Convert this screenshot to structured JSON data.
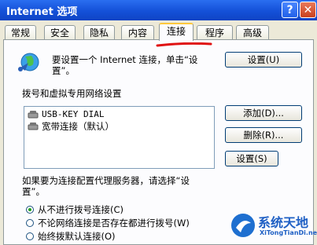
{
  "window": {
    "title": "Internet 选项"
  },
  "title_buttons": {
    "help": "?",
    "close": "✕"
  },
  "tabs": [
    "常规",
    "安全",
    "隐私",
    "内容",
    "连接",
    "程序",
    "高级"
  ],
  "active_tab": "连接",
  "setup": {
    "text_line1": "要设置一个 Internet 连接，单击“设",
    "text_line2": "置”。",
    "button": "设置(U)"
  },
  "dialup": {
    "section_label": "拨号和虚拟专用网络设置",
    "items": [
      "USB-KEY DIAL",
      "宽带连接（默认）"
    ],
    "add_button": "添加(D)...",
    "remove_button": "删除(R)...",
    "settings_button": "设置(S)"
  },
  "proxy": {
    "text_line1": "如果要为连接配置代理服务器，请选择“设",
    "text_line2": "置”。"
  },
  "radio_options": [
    "从不进行拨号连接(C)",
    "不论网络连接是否存在都进行拨号(W)",
    "始终拨默认连接(O)"
  ],
  "selected_radio": 0,
  "watermark": {
    "name": "系统天地",
    "url": "XiTongTianDi.net"
  }
}
